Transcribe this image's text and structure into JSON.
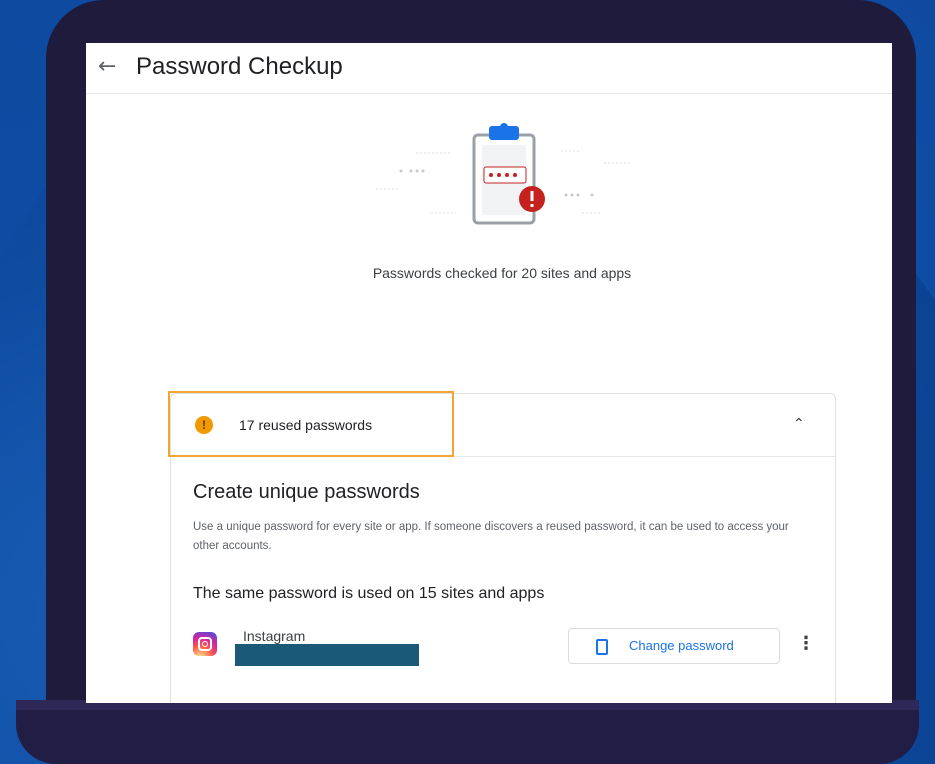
{
  "colors": {
    "background": "#0d4aa0",
    "laptop": "#1f1b3d",
    "accent_blue": "#1a73e8",
    "warning": "#f29900",
    "highlight_border": "#f2a533",
    "alert_red": "#c5221f"
  },
  "appbar": {
    "back_icon": "arrow-left-icon",
    "title": "Password Checkup"
  },
  "summary": {
    "text": "Passwords checked for 20 sites and apps"
  },
  "card": {
    "header_label": "17 reused passwords",
    "header_icon": "warning-icon",
    "collapse_icon": "chevron-up-icon",
    "heading": "Create unique passwords",
    "description": "Use a unique password for every site or app. If someone discovers a reused password, it can be used to access your other accounts.",
    "group_label": "The same password is used on 15 sites and apps",
    "rows": [
      {
        "site": "Instagram",
        "icon": "instagram-icon",
        "action_label": "Change password"
      }
    ]
  }
}
